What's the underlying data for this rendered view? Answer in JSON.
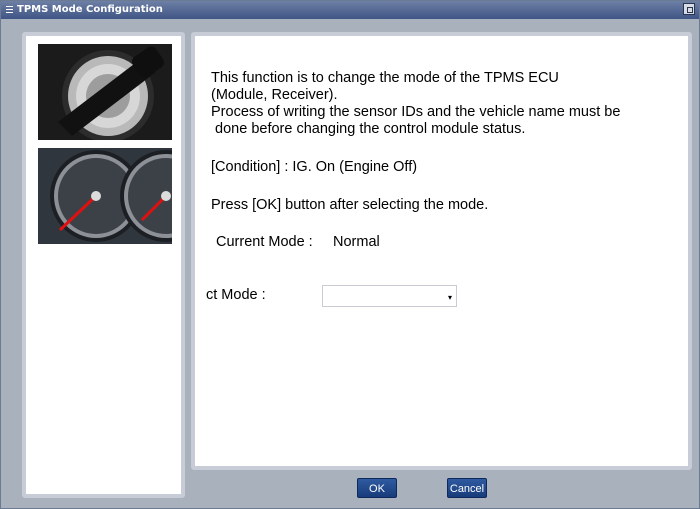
{
  "window": {
    "title": "TPMS Mode Configuration"
  },
  "icons": {
    "app": "app-menu-icon",
    "restore": "restore-icon"
  },
  "content": {
    "line1": "This function is to change the mode of the TPMS ECU",
    "line2": "(Module, Receiver).",
    "line3": "Process of writing the sensor IDs and the vehicle name must be",
    "line4": " done before changing the control module status.",
    "condition": "[Condition] : IG. On (Engine Off)",
    "instruction": "Press [OK] button after selecting the mode.",
    "current_mode_label": "Current Mode :",
    "current_mode_value": "Normal",
    "select_mode_label": "ct Mode :",
    "select_value": ""
  },
  "buttons": {
    "ok": "OK",
    "cancel": "Cancel"
  }
}
